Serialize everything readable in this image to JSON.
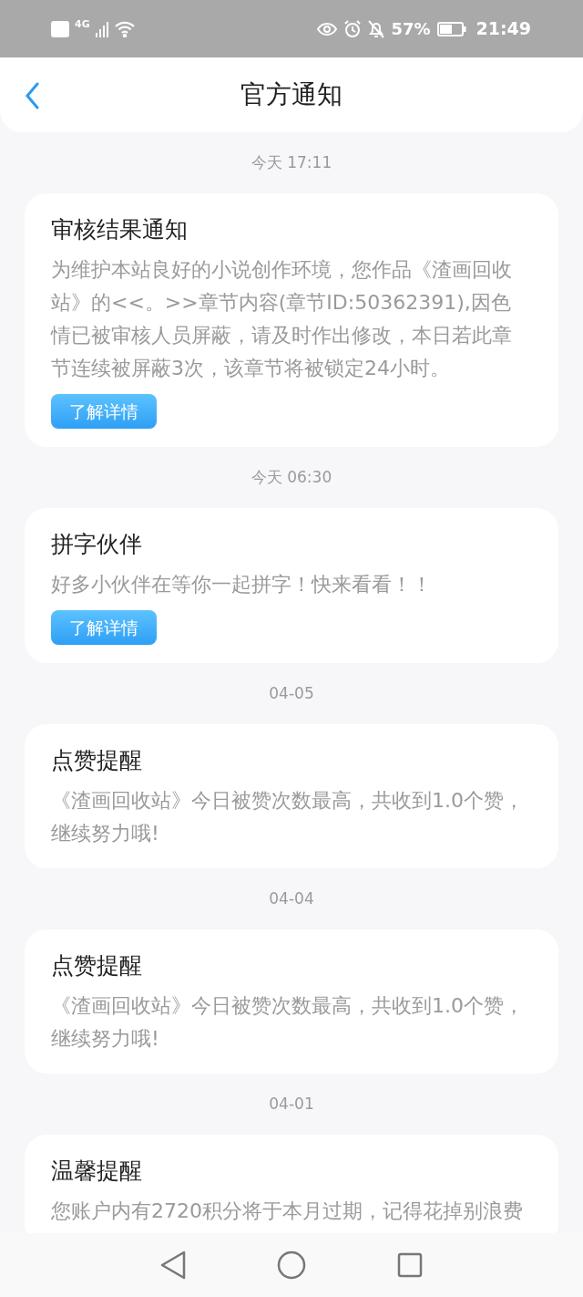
{
  "status_bar": {
    "network": "4G",
    "battery": "57%",
    "time": "21:49"
  },
  "header": {
    "title": "官方通知"
  },
  "groups": [
    {
      "time": "今天 17:11",
      "card": {
        "title": "审核结果通知",
        "body": "为维护本站良好的小说创作环境，您作品《渣画回收站》的<<。>>章节内容(章节ID:50362391),因色情已被审核人员屏蔽，请及时作出修改，本日若此章节连续被屏蔽3次，该章节将被锁定24小时。",
        "button": "了解详情"
      }
    },
    {
      "time": "今天 06:30",
      "card": {
        "title": "拼字伙伴",
        "body": "好多小伙伴在等你一起拼字！快来看看！！",
        "button": "了解详情"
      }
    },
    {
      "time": "04-05",
      "card": {
        "title": "点赞提醒",
        "body": "《渣画回收站》今日被赞次数最高，共收到1.0个赞，继续努力哦!"
      }
    },
    {
      "time": "04-04",
      "card": {
        "title": "点赞提醒",
        "body": "《渣画回收站》今日被赞次数最高，共收到1.0个赞，继续努力哦!"
      }
    },
    {
      "time": "04-01",
      "card": {
        "title": "温馨提醒",
        "body": "您账户内有2720积分将于本月过期，记得花掉别浪费"
      }
    }
  ]
}
